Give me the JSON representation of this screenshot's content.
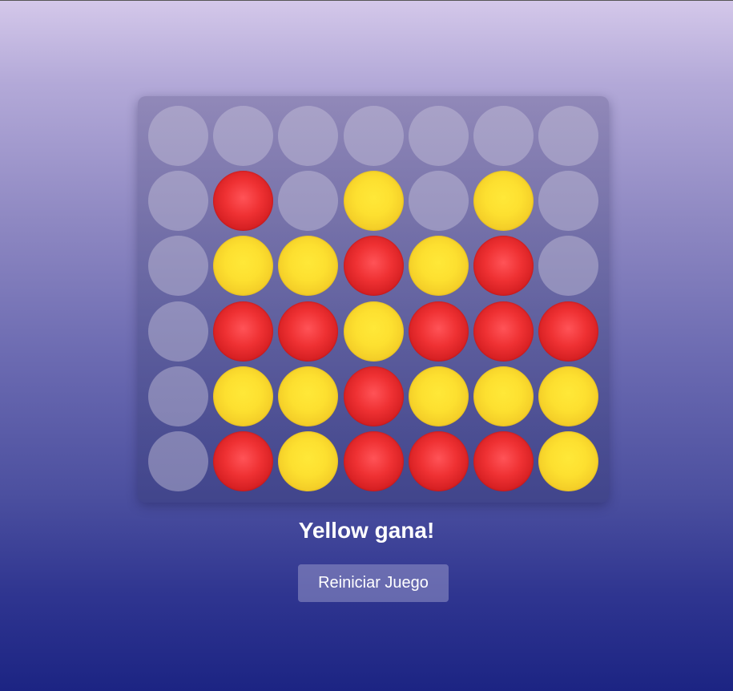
{
  "board": {
    "rows": 6,
    "columns": 7,
    "cells": [
      [
        "empty",
        "empty",
        "empty",
        "empty",
        "empty",
        "empty",
        "empty"
      ],
      [
        "empty",
        "red",
        "empty",
        "yellow",
        "empty",
        "yellow",
        "empty"
      ],
      [
        "empty",
        "yellow",
        "yellow",
        "red",
        "yellow",
        "red",
        "empty"
      ],
      [
        "empty",
        "red",
        "red",
        "yellow",
        "red",
        "red",
        "red"
      ],
      [
        "empty",
        "yellow",
        "yellow",
        "red",
        "yellow",
        "yellow",
        "yellow"
      ],
      [
        "empty",
        "red",
        "yellow",
        "red",
        "red",
        "red",
        "yellow"
      ]
    ],
    "colors": {
      "red": "#ef3133",
      "yellow": "#fde030",
      "empty": "#c8c3dc"
    }
  },
  "status": {
    "message": "Yellow gana!"
  },
  "controls": {
    "reset_label": "Reiniciar Juego"
  }
}
